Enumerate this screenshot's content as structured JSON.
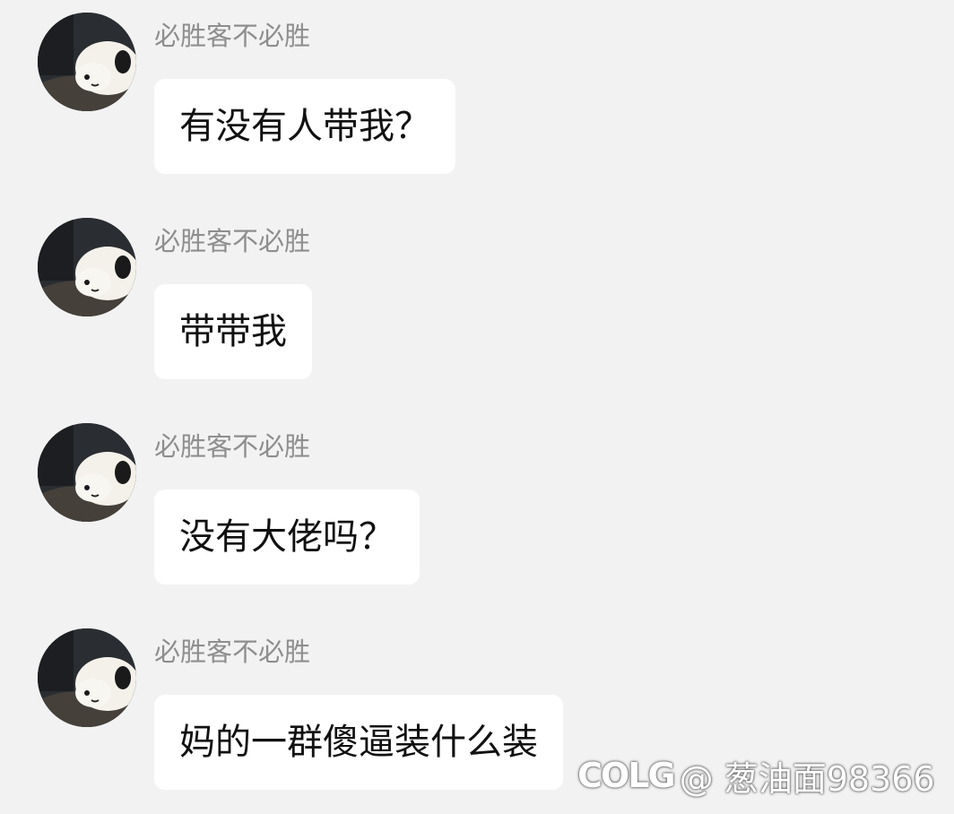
{
  "messages": [
    {
      "sender": "必胜客不必胜",
      "text": "有没有人带我？"
    },
    {
      "sender": "必胜客不必胜",
      "text": "带带我"
    },
    {
      "sender": "必胜客不必胜",
      "text": "没有大佬吗？"
    },
    {
      "sender": "必胜客不必胜",
      "text": "妈的一群傻逼装什么装"
    }
  ],
  "watermark": {
    "logo": "COLG",
    "text": "@ 葱油面98366"
  },
  "icons": {
    "avatar": "dog-avatar-icon"
  },
  "colors": {
    "background": "#f2f2f2",
    "bubble": "#ffffff",
    "sender_text": "#8e8e8e",
    "message_text": "#111111"
  }
}
